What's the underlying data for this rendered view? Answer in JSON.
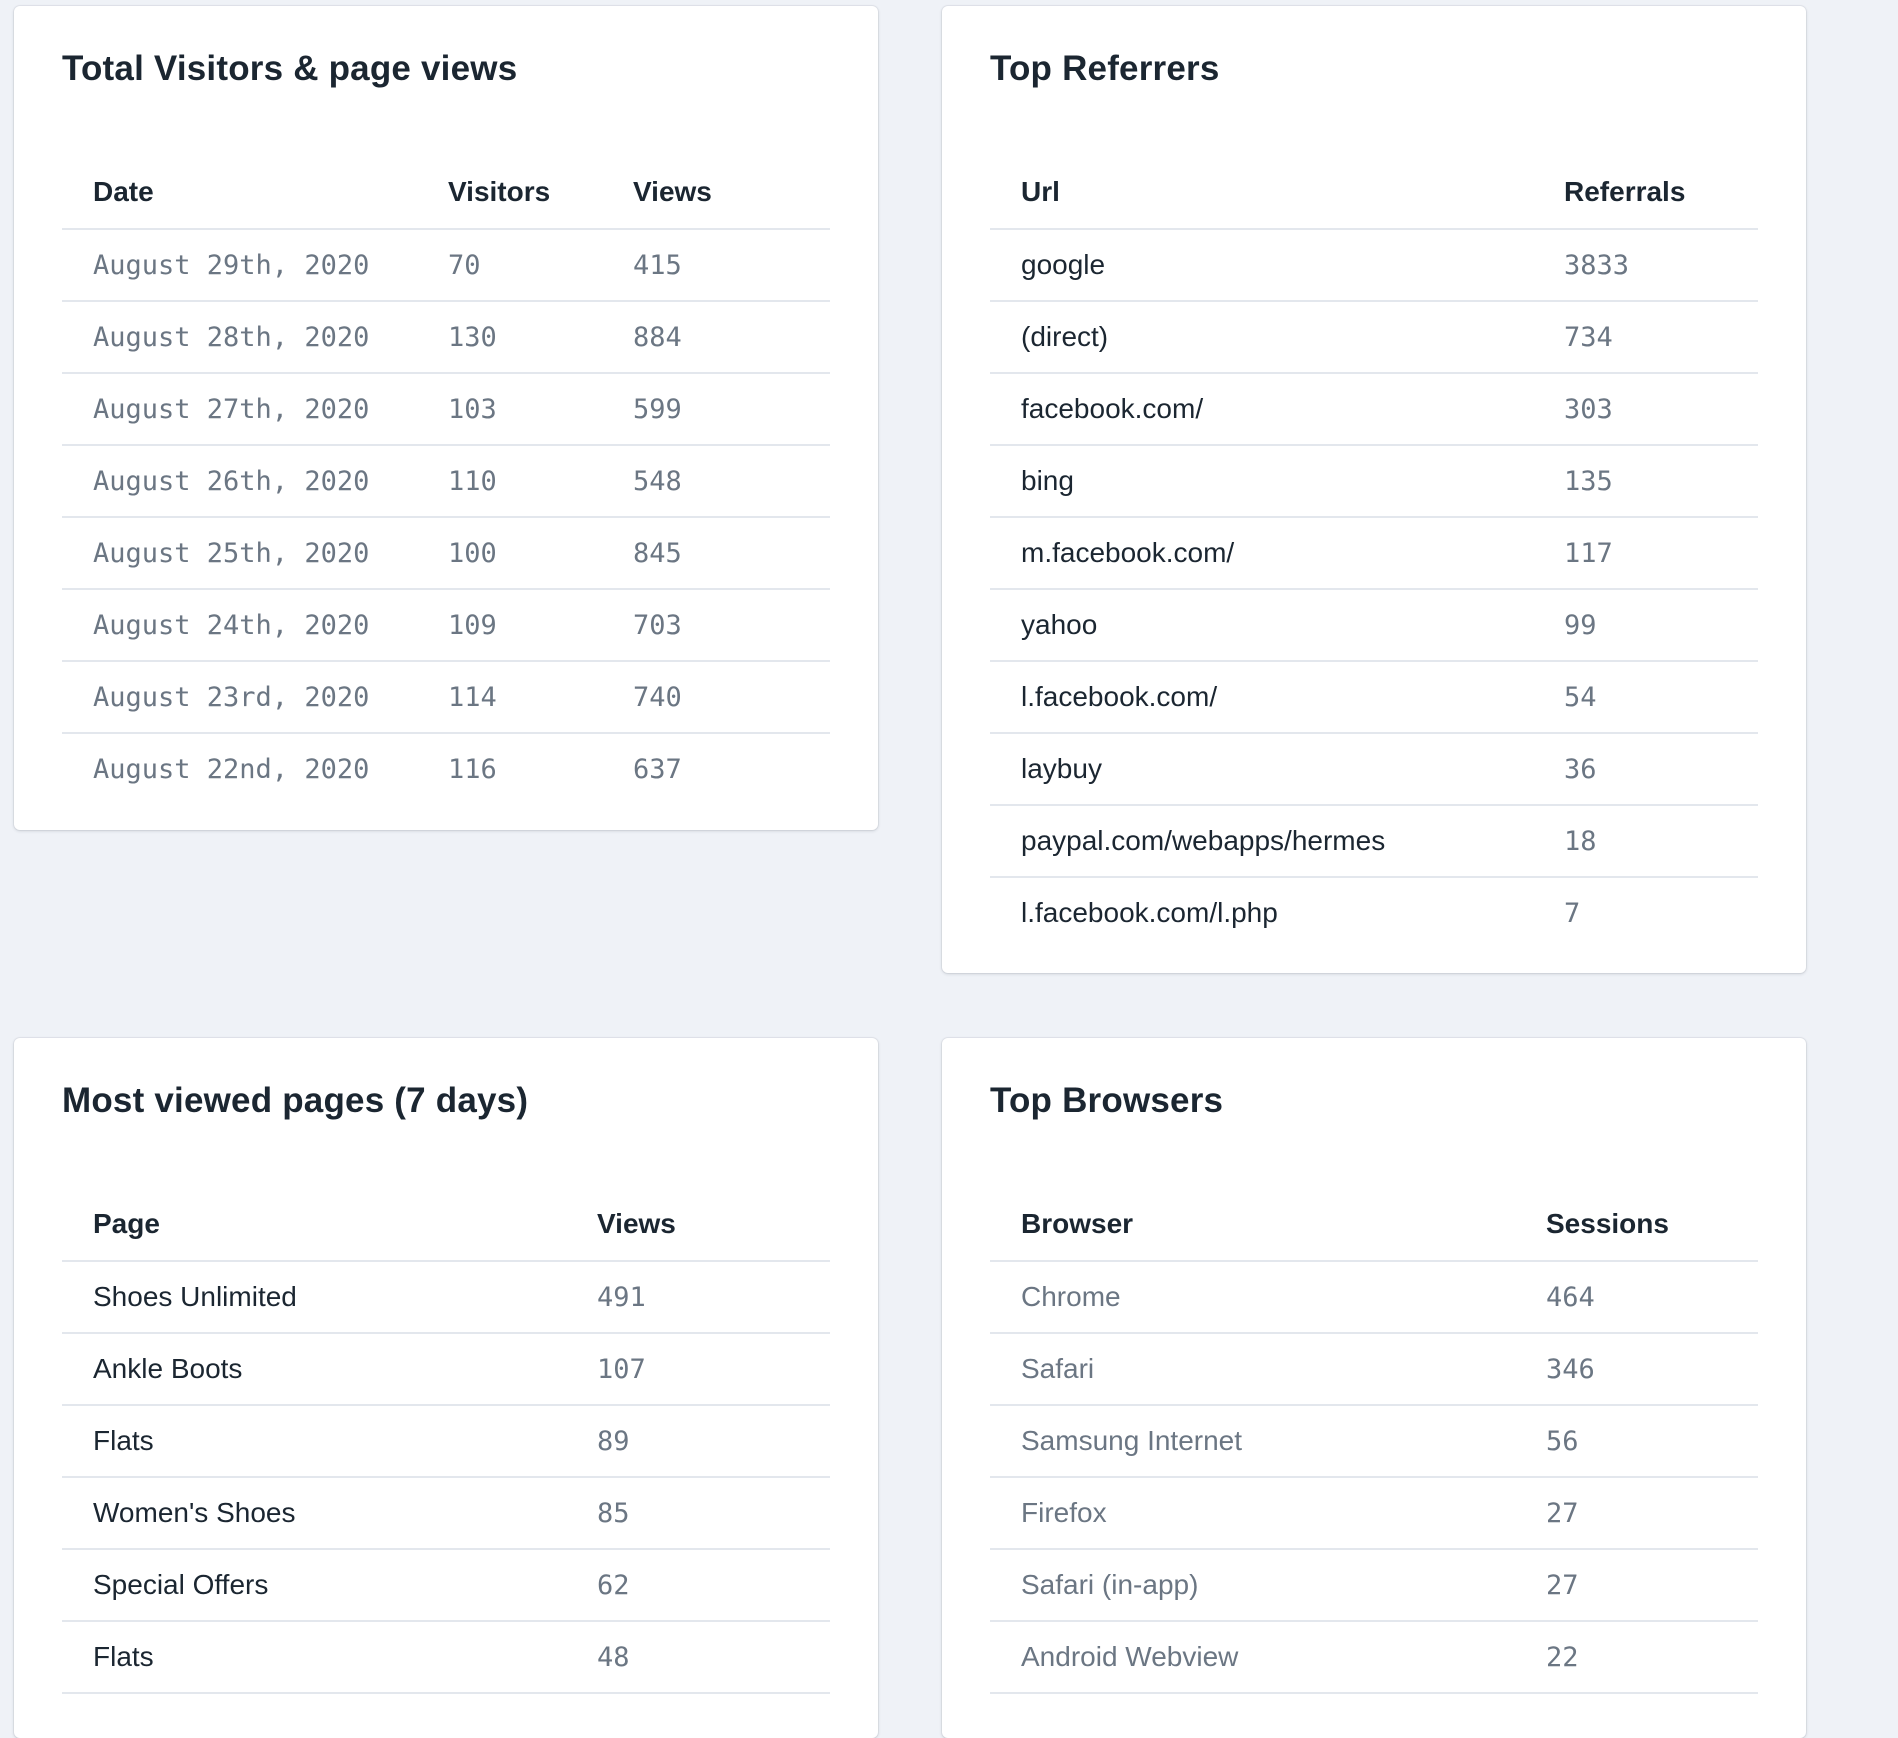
{
  "visitors": {
    "title": "Total Visitors & page views",
    "columns": [
      "Date",
      "Visitors",
      "Views"
    ],
    "rows": [
      {
        "date": "August 29th, 2020",
        "visitors": "70",
        "views": "415"
      },
      {
        "date": "August 28th, 2020",
        "visitors": "130",
        "views": "884"
      },
      {
        "date": "August 27th, 2020",
        "visitors": "103",
        "views": "599"
      },
      {
        "date": "August 26th, 2020",
        "visitors": "110",
        "views": "548"
      },
      {
        "date": "August 25th, 2020",
        "visitors": "100",
        "views": "845"
      },
      {
        "date": "August 24th, 2020",
        "visitors": "109",
        "views": "703"
      },
      {
        "date": "August 23rd, 2020",
        "visitors": "114",
        "views": "740"
      },
      {
        "date": "August 22nd, 2020",
        "visitors": "116",
        "views": "637"
      }
    ]
  },
  "referrers": {
    "title": "Top Referrers",
    "columns": [
      "Url",
      "Referrals"
    ],
    "rows": [
      {
        "url": "google",
        "referrals": "3833"
      },
      {
        "url": "(direct)",
        "referrals": "734"
      },
      {
        "url": "facebook.com/",
        "referrals": "303"
      },
      {
        "url": "bing",
        "referrals": "135"
      },
      {
        "url": "m.facebook.com/",
        "referrals": "117"
      },
      {
        "url": "yahoo",
        "referrals": "99"
      },
      {
        "url": "l.facebook.com/",
        "referrals": "54"
      },
      {
        "url": "laybuy",
        "referrals": "36"
      },
      {
        "url": "paypal.com/webapps/hermes",
        "referrals": "18"
      },
      {
        "url": "l.facebook.com/l.php",
        "referrals": "7"
      }
    ]
  },
  "pages": {
    "title": "Most viewed pages (7 days)",
    "columns": [
      "Page",
      "Views"
    ],
    "rows": [
      {
        "page": "Shoes Unlimited",
        "views": "491"
      },
      {
        "page": "Ankle Boots",
        "views": "107"
      },
      {
        "page": "Flats",
        "views": "89"
      },
      {
        "page": "Women's Shoes",
        "views": "85"
      },
      {
        "page": "Special Offers",
        "views": "62"
      },
      {
        "page": "Flats",
        "views": "48"
      }
    ]
  },
  "browsers": {
    "title": "Top Browsers",
    "columns": [
      "Browser",
      "Sessions"
    ],
    "rows": [
      {
        "browser": "Chrome",
        "sessions": "464"
      },
      {
        "browser": "Safari",
        "sessions": "346"
      },
      {
        "browser": "Samsung Internet",
        "sessions": "56"
      },
      {
        "browser": "Firefox",
        "sessions": "27"
      },
      {
        "browser": "Safari (in-app)",
        "sessions": "27"
      },
      {
        "browser": "Android Webview",
        "sessions": "22"
      }
    ]
  },
  "colors": {
    "background": "#eff2f7",
    "card": "#ffffff",
    "text": "#1b2631",
    "muted": "#6b7683",
    "divider": "#e3e7ed"
  }
}
